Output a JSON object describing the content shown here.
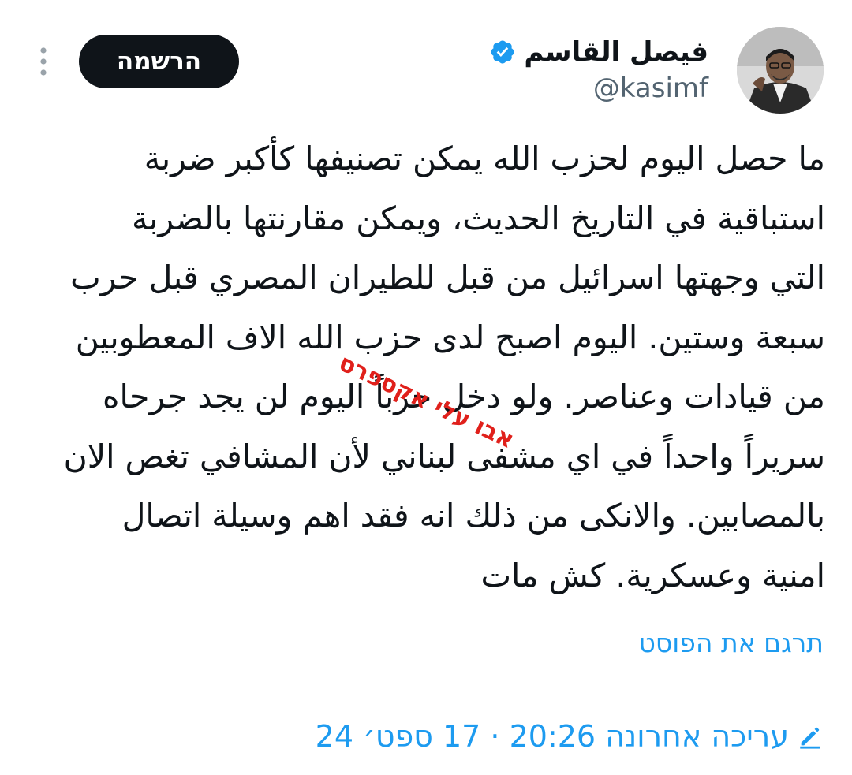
{
  "author": {
    "display_name": "فيصل القاسم",
    "handle": "@kasimf",
    "avatar_icon": "person-portrait-avatar",
    "verified_icon": "verified-badge-icon",
    "verified_color": "#1d9bf0"
  },
  "actions": {
    "subscribe_label": "הרשמה",
    "more_icon": "more-vertical-icon"
  },
  "tweet": {
    "lines": [
      "ما حصل اليوم لحزب الله يمكن تصنيفها كأكبر ضربة",
      "استباقية في التاريخ الحديث، ويمكن مقارنتها بالضربة",
      "التي وجهتها اسرائيل من قبل للطيران المصري قبل حرب",
      "سبعة وستين. اليوم اصبح لدى حزب الله  الاف المعطوبين",
      "من قيادات وعناصر. ولو دخل حرباً اليوم لن يجد جرحاه",
      "سريراً واحداً في اي مشفى لبناني لأن المشافي تغص الان",
      "بالمصابين. والانكى من ذلك انه فقد اهم وسيلة اتصال",
      "امنية وعسكرية. كش مات"
    ]
  },
  "watermark": {
    "text": "אבו עלי אקספרס",
    "color": "#e0201b"
  },
  "translate_label": "תרגם את הפוסט",
  "edited": {
    "icon": "edit-pencil-icon",
    "text": "עריכה אחרונה 20:26 · 17 ספט׳ 24"
  },
  "colors": {
    "accent": "#1d9bf0",
    "text": "#0f1419",
    "secondary": "#536471",
    "button_bg": "#0f1419"
  }
}
